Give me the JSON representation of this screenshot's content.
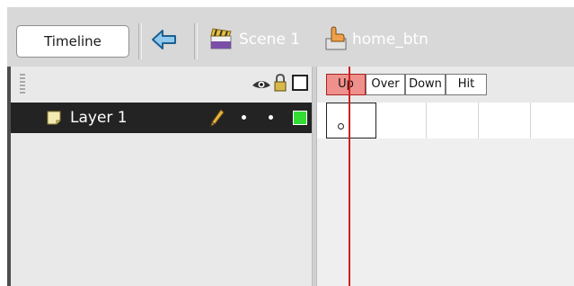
{
  "toolbar": {
    "timeline_button": "Timeline",
    "scene_label": "Scene 1",
    "symbol_label": "home_btn"
  },
  "layers": [
    {
      "name": "Layer 1",
      "outline_color": "#33dd33"
    }
  ],
  "frames": {
    "headers": [
      "Up",
      "Over",
      "Down",
      "Hit"
    ],
    "current": "Up",
    "keyframe_at": "Up"
  },
  "colors": {
    "toolbar_bg": "#d8d8d8",
    "selected_layer_bg": "#232323",
    "playhead": "#cc2020",
    "current_frame_header": "#f0908c"
  },
  "icons": {
    "back": "back-arrow-icon",
    "scene": "clapperboard-icon",
    "symbol": "button-symbol-icon",
    "show_hide": "eye-icon",
    "lock": "lock-icon",
    "outline": "outline-square-icon",
    "layer": "layer-page-icon",
    "edit": "pencil-icon"
  }
}
